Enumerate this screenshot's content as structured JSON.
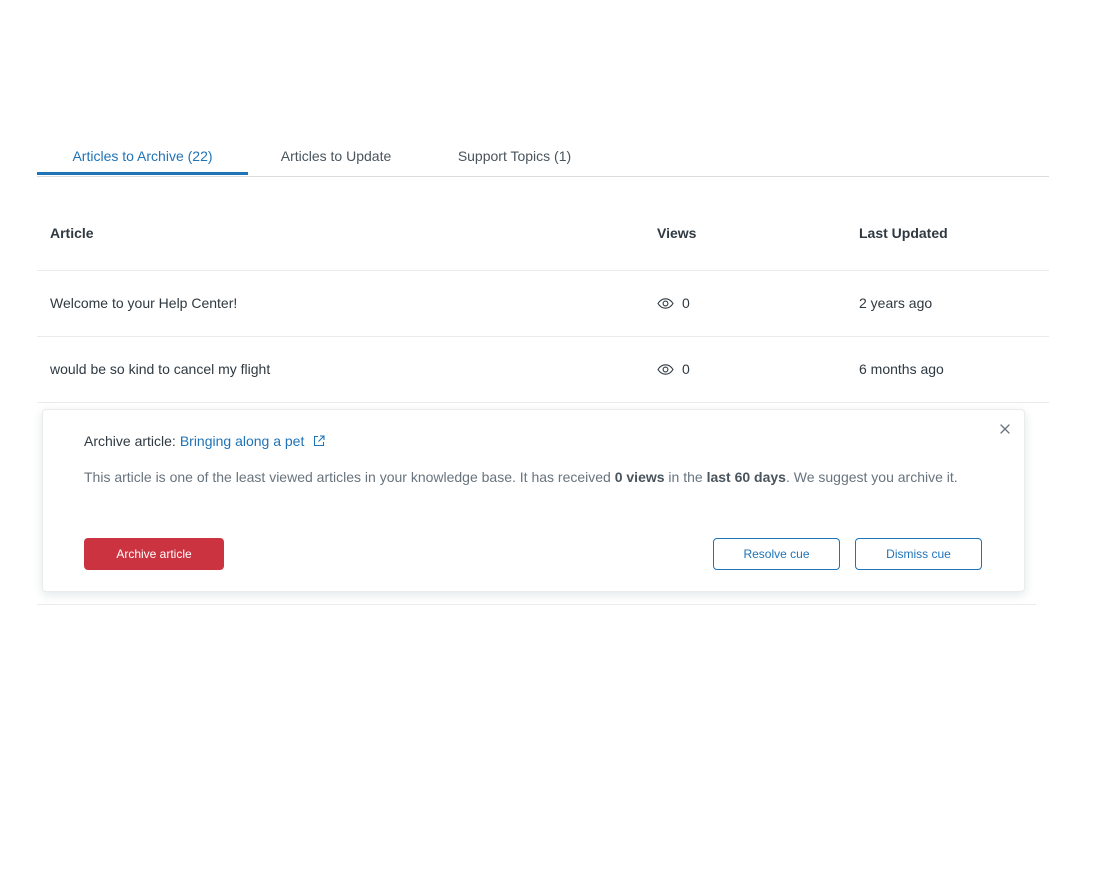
{
  "tabs": [
    {
      "label": "Articles to Archive (22)",
      "active": true
    },
    {
      "label": "Articles to Update",
      "active": false
    },
    {
      "label": "Support Topics (1)",
      "active": false
    }
  ],
  "table": {
    "columns": [
      "Article",
      "Views",
      "Last Updated"
    ],
    "rows": [
      {
        "article": "Welcome to your Help Center!",
        "views": "0",
        "updated": "2 years ago"
      },
      {
        "article": "would be so kind to cancel my flight",
        "views": "0",
        "updated": "6 months ago"
      }
    ]
  },
  "cue": {
    "title_prefix": "Archive article:",
    "link_text": "Bringing along a pet",
    "body_1": "This article is one of the least viewed articles in your knowledge base. It has received ",
    "body_views": "0 views",
    "body_2": " in the ",
    "body_period": "last 60 days",
    "body_3": ". We suggest you archive it.",
    "archive_label": "Archive article",
    "resolve_label": "Resolve cue",
    "dismiss_label": "Dismiss cue"
  },
  "icons": {
    "views": "eye-icon",
    "external": "external-link-icon",
    "close": "close-icon"
  },
  "colors": {
    "accent": "#1f73b7",
    "danger": "#cc3340",
    "text": "#2f3941",
    "muted": "#68737d"
  }
}
